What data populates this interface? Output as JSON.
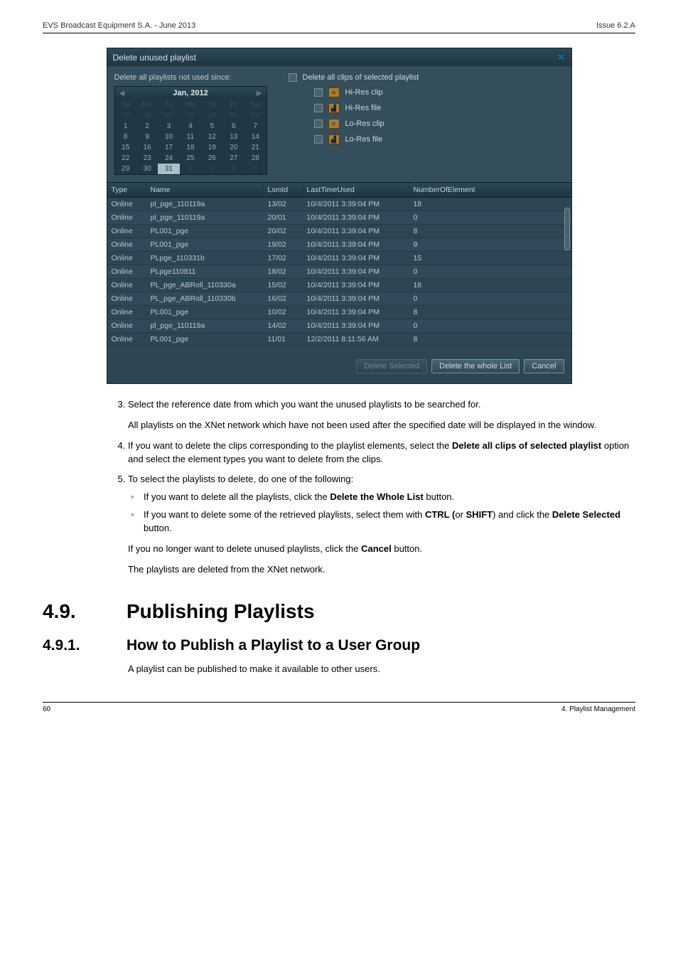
{
  "header": {
    "left": "EVS Broadcast Equipment S.A. - June 2013",
    "right": "Issue 6.2.A"
  },
  "dialog": {
    "title": "Delete unused playlist",
    "left_label": "Delete all playlists not used since:",
    "right_label": "Delete all clips of selected playlist",
    "options": [
      {
        "label": "Hi-Res clip",
        "icon": "vid"
      },
      {
        "label": "Hi-Res file",
        "icon": "file"
      },
      {
        "label": "Lo-Res clip",
        "icon": "vid"
      },
      {
        "label": "Lo-Res file",
        "icon": "file"
      }
    ],
    "buttons": {
      "del_sel": "Delete Selected",
      "del_whole": "Delete the whole List",
      "cancel": "Cancel"
    }
  },
  "calendar": {
    "month": "Jan, 2012",
    "weekdays": [
      "Su",
      "Mo",
      "Tu",
      "We",
      "Th",
      "Fr",
      "Sa"
    ],
    "rows": [
      [
        {
          "d": "25",
          "o": true
        },
        {
          "d": "26",
          "o": true
        },
        {
          "d": "27",
          "o": true
        },
        {
          "d": "28",
          "o": true
        },
        {
          "d": "29",
          "o": true
        },
        {
          "d": "30",
          "o": true
        },
        {
          "d": "31",
          "o": true
        }
      ],
      [
        {
          "d": "1"
        },
        {
          "d": "2"
        },
        {
          "d": "3"
        },
        {
          "d": "4"
        },
        {
          "d": "5"
        },
        {
          "d": "6"
        },
        {
          "d": "7"
        }
      ],
      [
        {
          "d": "8"
        },
        {
          "d": "9"
        },
        {
          "d": "10"
        },
        {
          "d": "11"
        },
        {
          "d": "12"
        },
        {
          "d": "13"
        },
        {
          "d": "14"
        }
      ],
      [
        {
          "d": "15"
        },
        {
          "d": "16"
        },
        {
          "d": "17"
        },
        {
          "d": "18"
        },
        {
          "d": "19"
        },
        {
          "d": "20"
        },
        {
          "d": "21"
        }
      ],
      [
        {
          "d": "22"
        },
        {
          "d": "23"
        },
        {
          "d": "24"
        },
        {
          "d": "25"
        },
        {
          "d": "26"
        },
        {
          "d": "27"
        },
        {
          "d": "28"
        }
      ],
      [
        {
          "d": "29"
        },
        {
          "d": "30"
        },
        {
          "d": "31",
          "sel": true
        },
        {
          "d": "1",
          "o": true
        },
        {
          "d": "2",
          "o": true
        },
        {
          "d": "3",
          "o": true
        },
        {
          "d": "4",
          "o": true
        }
      ]
    ]
  },
  "grid": {
    "headers": {
      "type": "Type",
      "name": "Name",
      "lsm": "LsmId",
      "last": "LastTimeUsed",
      "num": "NumberOfElement"
    },
    "rows": [
      {
        "type": "Online",
        "name": "pl_pge_110119a",
        "lsm": "13/02",
        "last": "10/4/2011 3:39:04 PM",
        "num": "18"
      },
      {
        "type": "Online",
        "name": "pl_pge_110119a",
        "lsm": "20/01",
        "last": "10/4/2011 3:39:04 PM",
        "num": "0"
      },
      {
        "type": "Online",
        "name": "PL001_pge",
        "lsm": "20/02",
        "last": "10/4/2011 3:39:04 PM",
        "num": "8"
      },
      {
        "type": "Online",
        "name": "PL001_pge",
        "lsm": "19/02",
        "last": "10/4/2011 3:39:04 PM",
        "num": "9"
      },
      {
        "type": "Online",
        "name": "PLpge_110331b",
        "lsm": "17/02",
        "last": "10/4/2011 3:39:04 PM",
        "num": "15"
      },
      {
        "type": "Online",
        "name": "PLpge110811",
        "lsm": "18/02",
        "last": "10/4/2011 3:39:04 PM",
        "num": "0"
      },
      {
        "type": "Online",
        "name": "PL_pge_ABRoll_110330a",
        "lsm": "15/02",
        "last": "10/4/2011 3:39:04 PM",
        "num": "18"
      },
      {
        "type": "Online",
        "name": "PL_pge_ABRoll_110330b",
        "lsm": "16/02",
        "last": "10/4/2011 3:39:04 PM",
        "num": "0"
      },
      {
        "type": "Online",
        "name": "PL001_pge",
        "lsm": "10/02",
        "last": "10/4/2011 3:39:04 PM",
        "num": "8"
      },
      {
        "type": "Online",
        "name": "pl_pge_110119a",
        "lsm": "14/02",
        "last": "10/4/2011 3:39:04 PM",
        "num": "0"
      },
      {
        "type": "Online",
        "name": "PL001_pge",
        "lsm": "11/01",
        "last": "12/2/2011 8:11:56 AM",
        "num": "8"
      }
    ]
  },
  "body": {
    "step3": "Select the reference date from which you want the unused playlists to be searched for.",
    "step3b": "All playlists on the XNet network which have not been used after the specified date will be displayed in the window.",
    "step4a": "If you want to delete the clips corresponding to the playlist elements, select the ",
    "step4bold": "Delete all clips of selected playlist",
    "step4b": " option and select the element types you want to delete from the clips.",
    "step5": "To select the playlists to delete, do one of the following:",
    "sub1a": "If you want to delete all the playlists, click the ",
    "sub1bold": "Delete the Whole List",
    "sub1b": " button.",
    "sub2a": "If you want to delete some of the retrieved playlists, select them with ",
    "sub2bold1": "CTRL (",
    "sub2mid": "or ",
    "sub2bold2": "SHIFT",
    "sub2b": ") and click the ",
    "sub2bold3": "Delete Selected",
    "sub2c": " button.",
    "nolonger_a": "If you no longer want to delete unused playlists, click the ",
    "nolonger_bold": "Cancel",
    "nolonger_b": " button.",
    "final": "The playlists are deleted from the XNet network."
  },
  "headings": {
    "h1num": "4.9.",
    "h1": "Publishing Playlists",
    "h2num": "4.9.1.",
    "h2": "How to Publish a Playlist to a User Group",
    "h2body": "A playlist can be published to make it available to other users."
  },
  "footer": {
    "left": "60",
    "right": "4. Playlist Management"
  }
}
